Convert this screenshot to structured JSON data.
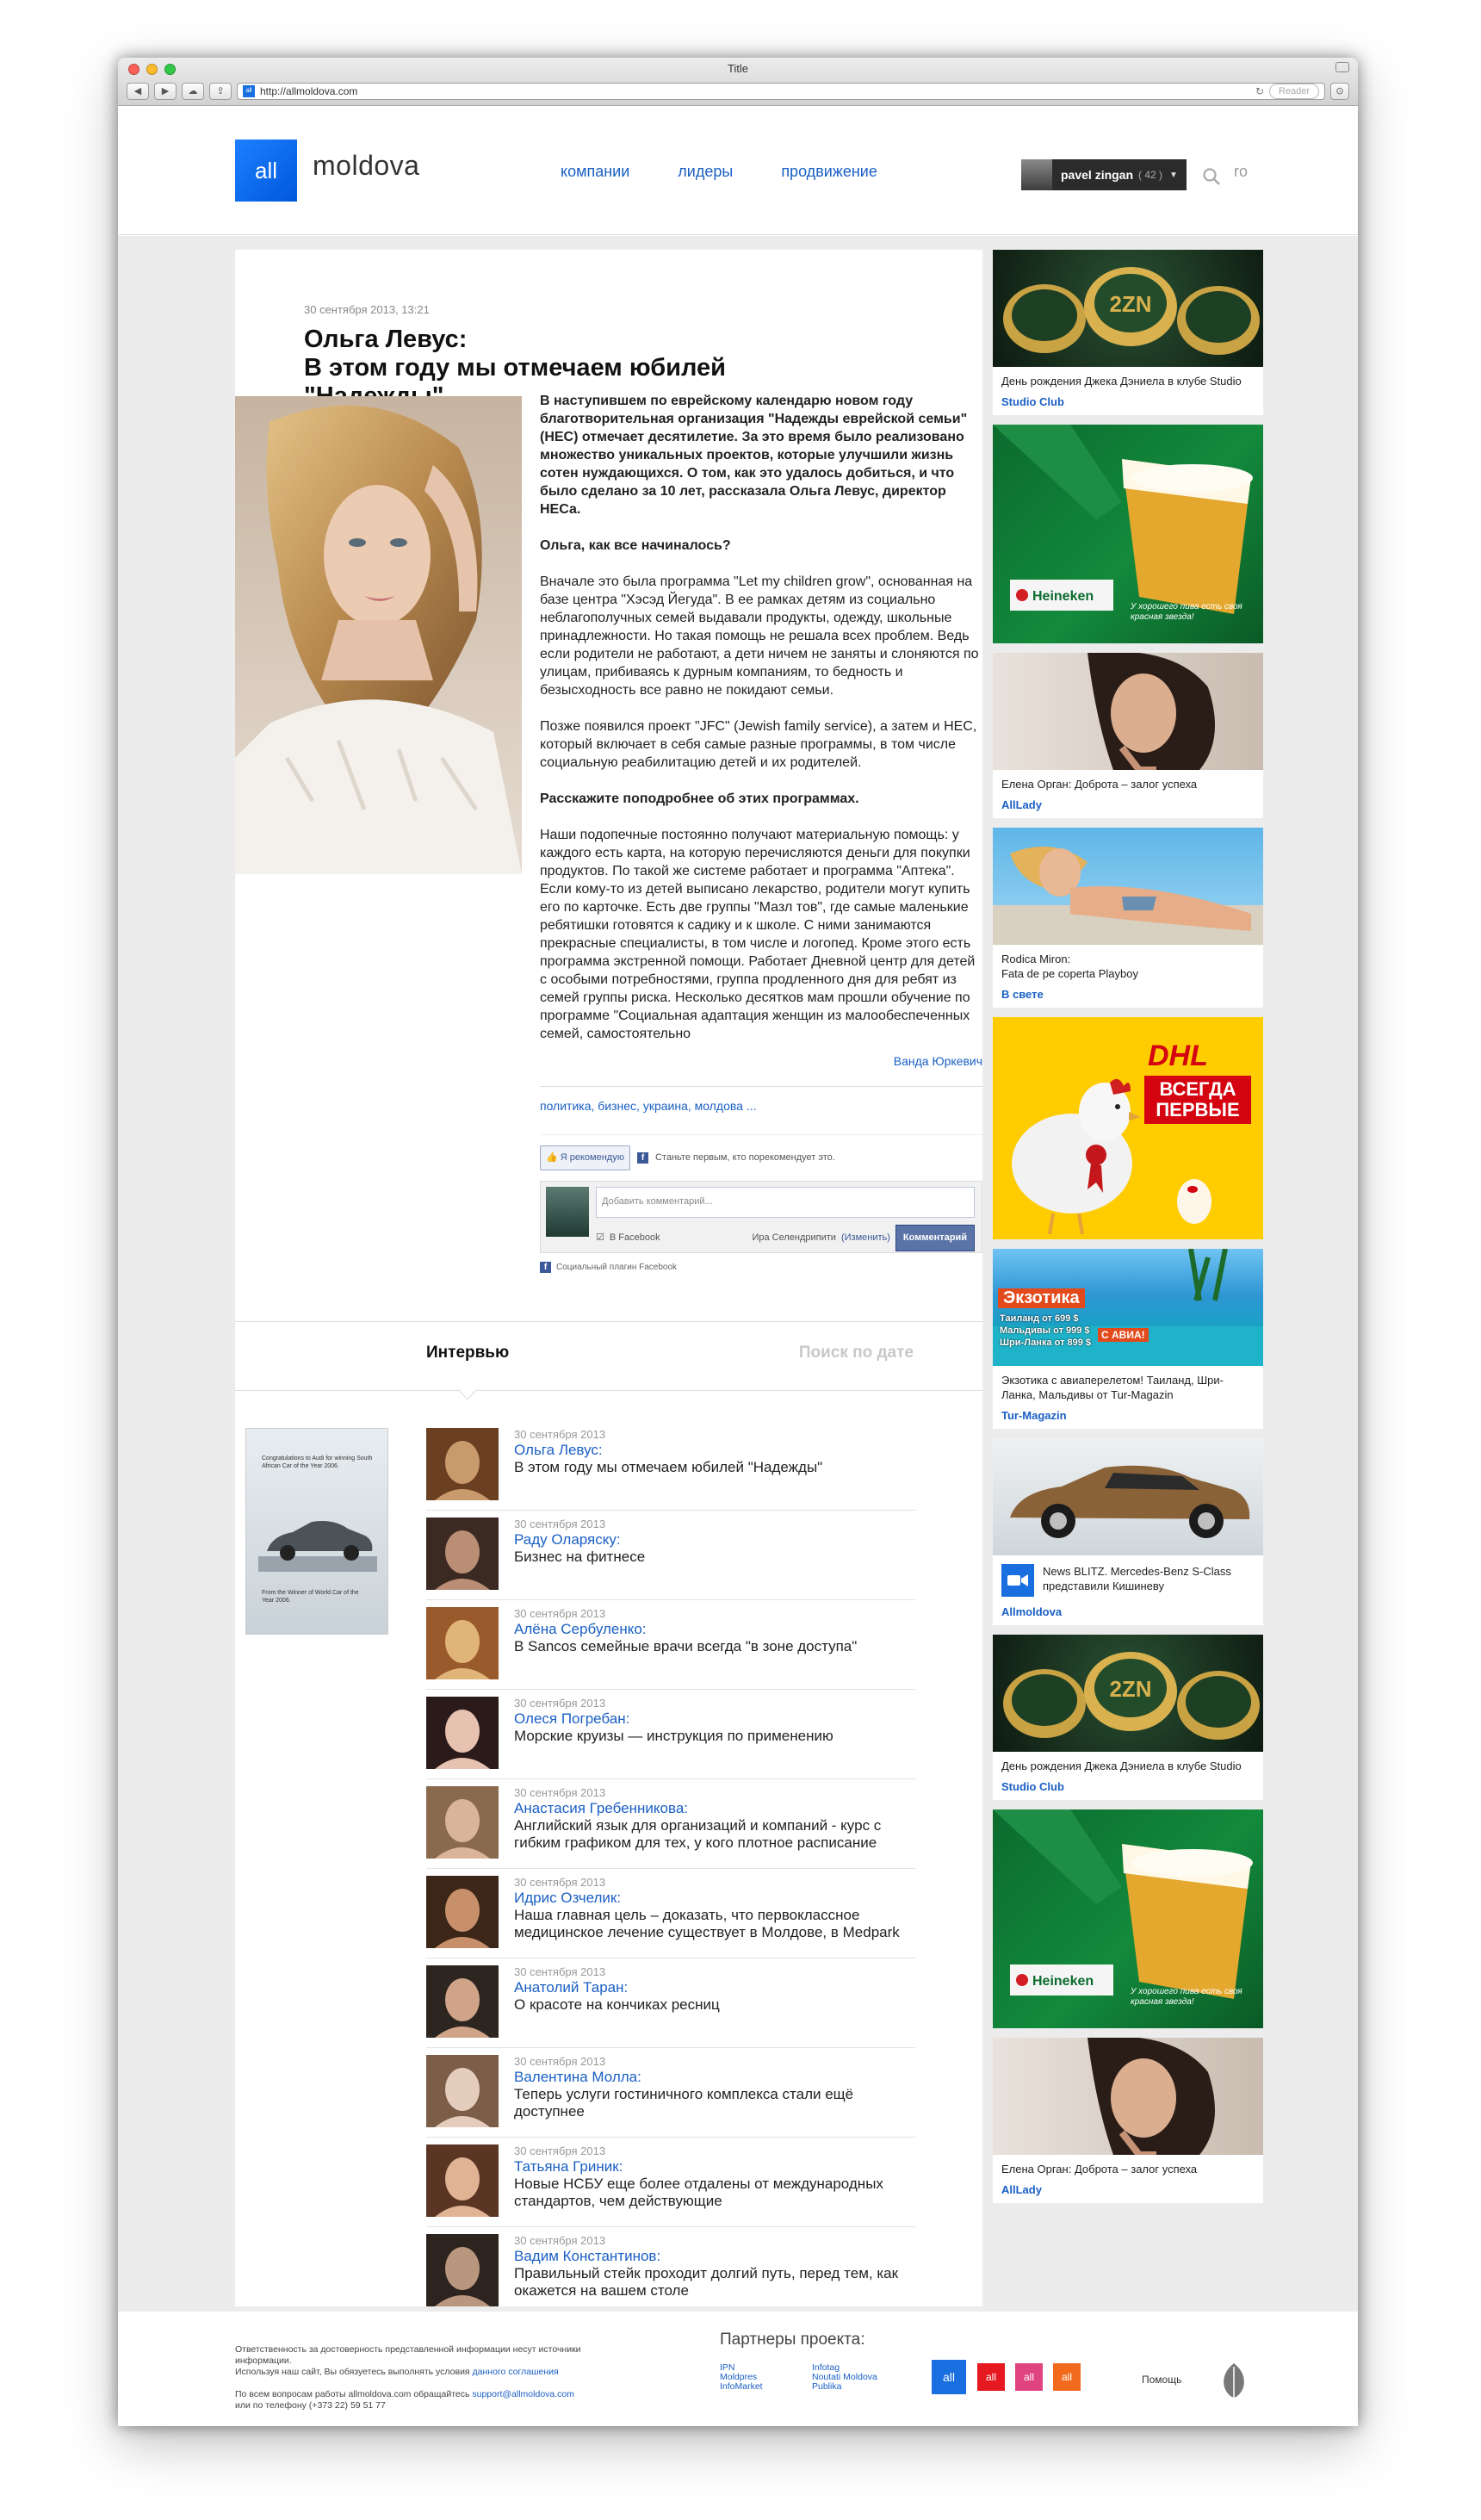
{
  "browser": {
    "window_title": "Title",
    "url": "http://allmoldova.com",
    "reader_label": "Reader"
  },
  "header": {
    "logo_box": "all",
    "logo_text": "moldova",
    "nav": [
      "компании",
      "лидеры",
      "продвижение"
    ],
    "user_name": "pavel zingan",
    "user_count": "( 42 )",
    "lang": "ro"
  },
  "article": {
    "date": "30 сентября 2013, 13:21",
    "title_line1": "Ольга Левус:",
    "title_line2": "В этом году мы отмечаем юбилей \"Надежды\"",
    "lead": "В наступившем по еврейскому календарю новом  году благотворительная  организация  \"Надежды еврейской семьи\" (НЕС) отмечает десятилетие. За это время было реализовано множество уникальных проектов, которые улучшили жизнь сотен нуждающихся. О том, как это удалось добиться, и что было сделано за 10 лет, рассказала Ольга Левус, директор НЕСа.",
    "q1": "Ольга, как все начиналось?",
    "p1": "Вначале это была  программа \"Let my children grow\", основанная на базе центра \"Хэсэд Йегуда\". В ее рамках детям из социально неблагополучных семей выдавали продукты, одежду, школьные принадлежности. Но такая помощь не решала всех проблем. Ведь если родители не работают, а дети ничем не заняты и слоняются по улицам, прибиваясь к дурным компаниям, то бедность и безысходность все равно не покидают семьи.",
    "p2": "Позже появился проект \"JFC\" (Jewish family service), а затем и НЕС, который включает в себя самые разные программы, в том числе социальную реабилитацию детей и их родителей.",
    "q2": "Расскажите поподробнее об этих  программах.",
    "p3": "Наши подопечные  постоянно получают материальную помощь: у каждого есть  карта, на которую перечисляются деньги для покупки продуктов. По такой же системе работает и программа \"Аптека\".  Если кому-то из детей выписано лекарство,  родители могут купить его по карточке. Есть две группы \"Мазл тов\", где самые маленькие ребятишки готовятся к садику и к школе. С ними занимаются прекрасные специалисты, в том числе и логопед. Кроме этого есть программа экстренной помощи. Работает Дневной центр для детей с особыми потребностями, группа продленного дня для ребят из семей группы риска. Несколько десятков мам прошли обучение по программе \"Социальная адаптация  женщин из малообеспеченных семей, самостоятельно",
    "author": "Ванда Юркевич",
    "tags": "политика, бизнес, украина, молдова ..."
  },
  "facebook": {
    "like_label": "Я рекомендую",
    "like_text": "Станьте первым, кто порекомендует это.",
    "comment_placeholder": "Добавить комментарий...",
    "post_to": "В Facebook",
    "posting_as": "Ира Селендрипити",
    "change_label": "(Изменить)",
    "submit_label": "Комментарий",
    "plugin_label": "Социальный плагин Facebook"
  },
  "interviews": {
    "heading": "Интервью",
    "date_search": "Поиск по дате",
    "ad_text": "Congratulations to Audi for winning South African Car of the Year 2006.",
    "ad_footer": "From the Winner of World Car of the Year 2006.",
    "items": [
      {
        "date": "30 сентября 2013",
        "name": "Ольга Левус:",
        "title": "В этом году мы отмечаем юбилей \"Надежды\""
      },
      {
        "date": "30 сентября 2013",
        "name": "Раду Оларяску:",
        "title": "Бизнес на фитнесе"
      },
      {
        "date": "30 сентября 2013",
        "name": "Алёна Сербуленко:",
        "title": "В Sancos семейные врачи всегда \"в зоне доступа\""
      },
      {
        "date": "30 сентября 2013",
        "name": "Олеся Погребан:",
        "title": "Морские круизы — инструкция по применению"
      },
      {
        "date": "30 сентября 2013",
        "name": "Анастасия Гребенникова:",
        "title": "Английский язык для организаций и компаний - курс с гибким графиком для тех, у кого плотное расписание"
      },
      {
        "date": "30 сентября 2013",
        "name": "Идрис Озчелик:",
        "title": "Наша главная цель – доказать, что первоклассное медицинское лечение существует в Молдове, в Medpark"
      },
      {
        "date": "30 сентября 2013",
        "name": "Анатолий Таран:",
        "title": "О красоте на кончиках ресниц"
      },
      {
        "date": "30 сентября 2013",
        "name": "Валентина Молла:",
        "title": "Теперь услуги гостиничного комплекса стали ещё доступнее"
      },
      {
        "date": "30 сентября 2013",
        "name": "Татьяна Гриник:",
        "title": "Новые НСБУ еще более отдалены от международных стандартов, чем действующие"
      },
      {
        "date": "30 сентября 2013",
        "name": "Вадим Константинов:",
        "title": "Правильный стейк проходит долгий путь, перед тем, как окажется на вашем столе"
      }
    ]
  },
  "sidebar": {
    "card1": {
      "caption": "День рождения Джека Дэниела в клубе Studio",
      "source": "Studio Club",
      "coin_text": "2ZN"
    },
    "heineken1": {
      "brand": "Heineken",
      "slogan": "У хорошего пива есть своя красная звезда!"
    },
    "card2": {
      "caption": "Елена Орган: Доброта – залог успеха",
      "source": "AllLady"
    },
    "card3": {
      "caption_line1": "Rodica Miron:",
      "caption_line2": "Fata de pe coperta Playboy",
      "source": "В свете"
    },
    "dhl": {
      "logo": "DHL",
      "badge_line1": "ВСЕГДА",
      "badge_line2": "ПЕРВЫЕ"
    },
    "card4": {
      "banner_title": "Экзотика",
      "banner_l1": "Таиланд от 699 $",
      "banner_l2": "Мальдивы от 999 $",
      "banner_l3": "Шри-Ланка от 899 $",
      "banner_tag": "С АВИА!",
      "caption": "Экзотика с авиаперелетом! Таиланд, Шри-Ланка, Мальдивы от Tur-Magazin",
      "source": "Tur-Magazin"
    },
    "card5": {
      "news": "News BLITZ. Mercedes-Benz S-Class представили Кишиневу",
      "source": "Allmoldova"
    },
    "card6": {
      "caption": "День рождения Джека Дэниела в клубе Studio",
      "source": "Studio Club",
      "coin_text": "2ZN"
    },
    "heineken2": {
      "brand": "Heineken",
      "slogan": "У хорошего пива есть своя красная звезда!"
    },
    "card7": {
      "caption": "Елена Орган: Доброта – залог успеха",
      "source": "AllLady"
    }
  },
  "footer": {
    "disclaimer_line1": "Ответственность за достоверность представленной информации несут источники информации.",
    "disclaimer_line2": "Используя наш сайт, Вы обязуетесь выполнять условия",
    "disclaimer_link": "данного соглашения",
    "contact_line1": "По всем вопросам работы allmoldova.com обращайтесь",
    "contact_email": "support@allmoldova.com",
    "contact_line2": "или по телефону (+373 22) 59 51 77",
    "partners_title": "Партнеры проекта:",
    "partners": [
      "IPN",
      "Infotag",
      "Moldpres",
      "Noutati Moldova",
      "InfoMarket",
      "Publika"
    ],
    "boxes": [
      "all",
      "all",
      "all",
      "all"
    ],
    "help": "Помощь",
    "colors": {
      "blue": "#1a6fe0",
      "red": "#e5191f",
      "pink": "#e0447e",
      "orange": "#f26b1d"
    }
  }
}
